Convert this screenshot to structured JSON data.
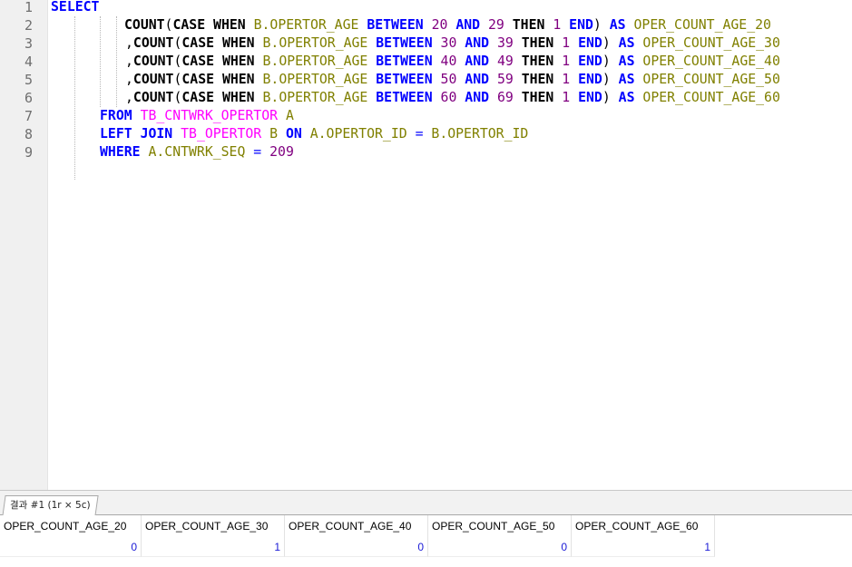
{
  "editor": {
    "line_numbers": [
      "1",
      "2",
      "3",
      "4",
      "5",
      "6",
      "7",
      "8",
      "9"
    ],
    "lines": [
      [
        {
          "t": "SELECT",
          "c": "kw-b"
        }
      ],
      [
        {
          "t": "COUNT",
          "c": "kw-k"
        },
        {
          "t": "(",
          "c": "pn"
        },
        {
          "t": "CASE",
          "c": "kw-k"
        },
        {
          "t": " ",
          "c": "pl"
        },
        {
          "t": "WHEN",
          "c": "kw-k"
        },
        {
          "t": " ",
          "c": "pl"
        },
        {
          "t": "B.OPERTOR_AGE",
          "c": "id"
        },
        {
          "t": " ",
          "c": "pl"
        },
        {
          "t": "BETWEEN",
          "c": "kw-b"
        },
        {
          "t": " ",
          "c": "pl"
        },
        {
          "t": "20",
          "c": "num"
        },
        {
          "t": " ",
          "c": "pl"
        },
        {
          "t": "AND",
          "c": "kw-b"
        },
        {
          "t": " ",
          "c": "pl"
        },
        {
          "t": "29",
          "c": "num"
        },
        {
          "t": " ",
          "c": "pl"
        },
        {
          "t": "THEN",
          "c": "kw-k"
        },
        {
          "t": " ",
          "c": "pl"
        },
        {
          "t": "1",
          "c": "num"
        },
        {
          "t": " ",
          "c": "pl"
        },
        {
          "t": "END",
          "c": "kw-b"
        },
        {
          "t": ")",
          "c": "pn"
        },
        {
          "t": " ",
          "c": "pl"
        },
        {
          "t": "AS",
          "c": "kw-b"
        },
        {
          "t": " ",
          "c": "pl"
        },
        {
          "t": "OPER_COUNT_AGE_20",
          "c": "id"
        }
      ],
      [
        {
          "t": ",",
          "c": "pn"
        },
        {
          "t": "COUNT",
          "c": "kw-k"
        },
        {
          "t": "(",
          "c": "pn"
        },
        {
          "t": "CASE",
          "c": "kw-k"
        },
        {
          "t": " ",
          "c": "pl"
        },
        {
          "t": "WHEN",
          "c": "kw-k"
        },
        {
          "t": " ",
          "c": "pl"
        },
        {
          "t": "B.OPERTOR_AGE",
          "c": "id"
        },
        {
          "t": " ",
          "c": "pl"
        },
        {
          "t": "BETWEEN",
          "c": "kw-b"
        },
        {
          "t": " ",
          "c": "pl"
        },
        {
          "t": "30",
          "c": "num"
        },
        {
          "t": " ",
          "c": "pl"
        },
        {
          "t": "AND",
          "c": "kw-b"
        },
        {
          "t": " ",
          "c": "pl"
        },
        {
          "t": "39",
          "c": "num"
        },
        {
          "t": " ",
          "c": "pl"
        },
        {
          "t": "THEN",
          "c": "kw-k"
        },
        {
          "t": " ",
          "c": "pl"
        },
        {
          "t": "1",
          "c": "num"
        },
        {
          "t": " ",
          "c": "pl"
        },
        {
          "t": "END",
          "c": "kw-b"
        },
        {
          "t": ")",
          "c": "pn"
        },
        {
          "t": " ",
          "c": "pl"
        },
        {
          "t": "AS",
          "c": "kw-b"
        },
        {
          "t": " ",
          "c": "pl"
        },
        {
          "t": "OPER_COUNT_AGE_30",
          "c": "id"
        }
      ],
      [
        {
          "t": ",",
          "c": "pn"
        },
        {
          "t": "COUNT",
          "c": "kw-k"
        },
        {
          "t": "(",
          "c": "pn"
        },
        {
          "t": "CASE",
          "c": "kw-k"
        },
        {
          "t": " ",
          "c": "pl"
        },
        {
          "t": "WHEN",
          "c": "kw-k"
        },
        {
          "t": " ",
          "c": "pl"
        },
        {
          "t": "B.OPERTOR_AGE",
          "c": "id"
        },
        {
          "t": " ",
          "c": "pl"
        },
        {
          "t": "BETWEEN",
          "c": "kw-b"
        },
        {
          "t": " ",
          "c": "pl"
        },
        {
          "t": "40",
          "c": "num"
        },
        {
          "t": " ",
          "c": "pl"
        },
        {
          "t": "AND",
          "c": "kw-b"
        },
        {
          "t": " ",
          "c": "pl"
        },
        {
          "t": "49",
          "c": "num"
        },
        {
          "t": " ",
          "c": "pl"
        },
        {
          "t": "THEN",
          "c": "kw-k"
        },
        {
          "t": " ",
          "c": "pl"
        },
        {
          "t": "1",
          "c": "num"
        },
        {
          "t": " ",
          "c": "pl"
        },
        {
          "t": "END",
          "c": "kw-b"
        },
        {
          "t": ")",
          "c": "pn"
        },
        {
          "t": " ",
          "c": "pl"
        },
        {
          "t": "AS",
          "c": "kw-b"
        },
        {
          "t": " ",
          "c": "pl"
        },
        {
          "t": "OPER_COUNT_AGE_40",
          "c": "id"
        }
      ],
      [
        {
          "t": ",",
          "c": "pn"
        },
        {
          "t": "COUNT",
          "c": "kw-k"
        },
        {
          "t": "(",
          "c": "pn"
        },
        {
          "t": "CASE",
          "c": "kw-k"
        },
        {
          "t": " ",
          "c": "pl"
        },
        {
          "t": "WHEN",
          "c": "kw-k"
        },
        {
          "t": " ",
          "c": "pl"
        },
        {
          "t": "B.OPERTOR_AGE",
          "c": "id"
        },
        {
          "t": " ",
          "c": "pl"
        },
        {
          "t": "BETWEEN",
          "c": "kw-b"
        },
        {
          "t": " ",
          "c": "pl"
        },
        {
          "t": "50",
          "c": "num"
        },
        {
          "t": " ",
          "c": "pl"
        },
        {
          "t": "AND",
          "c": "kw-b"
        },
        {
          "t": " ",
          "c": "pl"
        },
        {
          "t": "59",
          "c": "num"
        },
        {
          "t": " ",
          "c": "pl"
        },
        {
          "t": "THEN",
          "c": "kw-k"
        },
        {
          "t": " ",
          "c": "pl"
        },
        {
          "t": "1",
          "c": "num"
        },
        {
          "t": " ",
          "c": "pl"
        },
        {
          "t": "END",
          "c": "kw-b"
        },
        {
          "t": ")",
          "c": "pn"
        },
        {
          "t": " ",
          "c": "pl"
        },
        {
          "t": "AS",
          "c": "kw-b"
        },
        {
          "t": " ",
          "c": "pl"
        },
        {
          "t": "OPER_COUNT_AGE_50",
          "c": "id"
        }
      ],
      [
        {
          "t": ",",
          "c": "pn"
        },
        {
          "t": "COUNT",
          "c": "kw-k"
        },
        {
          "t": "(",
          "c": "pn"
        },
        {
          "t": "CASE",
          "c": "kw-k"
        },
        {
          "t": " ",
          "c": "pl"
        },
        {
          "t": "WHEN",
          "c": "kw-k"
        },
        {
          "t": " ",
          "c": "pl"
        },
        {
          "t": "B.OPERTOR_AGE",
          "c": "id"
        },
        {
          "t": " ",
          "c": "pl"
        },
        {
          "t": "BETWEEN",
          "c": "kw-b"
        },
        {
          "t": " ",
          "c": "pl"
        },
        {
          "t": "60",
          "c": "num"
        },
        {
          "t": " ",
          "c": "pl"
        },
        {
          "t": "AND",
          "c": "kw-b"
        },
        {
          "t": " ",
          "c": "pl"
        },
        {
          "t": "69",
          "c": "num"
        },
        {
          "t": " ",
          "c": "pl"
        },
        {
          "t": "THEN",
          "c": "kw-k"
        },
        {
          "t": " ",
          "c": "pl"
        },
        {
          "t": "1",
          "c": "num"
        },
        {
          "t": " ",
          "c": "pl"
        },
        {
          "t": "END",
          "c": "kw-b"
        },
        {
          "t": ")",
          "c": "pn"
        },
        {
          "t": " ",
          "c": "pl"
        },
        {
          "t": "AS",
          "c": "kw-b"
        },
        {
          "t": " ",
          "c": "pl"
        },
        {
          "t": "OPER_COUNT_AGE_60",
          "c": "id"
        }
      ],
      [
        {
          "t": "FROM",
          "c": "kw-b"
        },
        {
          "t": " ",
          "c": "pl"
        },
        {
          "t": "TB_CNTWRK_OPERTOR",
          "c": "tb"
        },
        {
          "t": " ",
          "c": "pl"
        },
        {
          "t": "A",
          "c": "id"
        }
      ],
      [
        {
          "t": "LEFT",
          "c": "kw-b"
        },
        {
          "t": " ",
          "c": "pl"
        },
        {
          "t": "JOIN",
          "c": "kw-b"
        },
        {
          "t": " ",
          "c": "pl"
        },
        {
          "t": "TB_OPERTOR",
          "c": "tb"
        },
        {
          "t": " ",
          "c": "pl"
        },
        {
          "t": "B",
          "c": "id"
        },
        {
          "t": " ",
          "c": "pl"
        },
        {
          "t": "ON",
          "c": "kw-b"
        },
        {
          "t": " ",
          "c": "pl"
        },
        {
          "t": "A.OPERTOR_ID",
          "c": "id"
        },
        {
          "t": " ",
          "c": "pl"
        },
        {
          "t": "=",
          "c": "op"
        },
        {
          "t": " ",
          "c": "pl"
        },
        {
          "t": "B.OPERTOR_ID",
          "c": "id"
        }
      ],
      [
        {
          "t": "WHERE",
          "c": "kw-b"
        },
        {
          "t": " ",
          "c": "pl"
        },
        {
          "t": "A.CNTWRK_SEQ",
          "c": "id"
        },
        {
          "t": " ",
          "c": "pl"
        },
        {
          "t": "=",
          "c": "op"
        },
        {
          "t": " ",
          "c": "pl"
        },
        {
          "t": "209",
          "c": "num"
        }
      ]
    ]
  },
  "results": {
    "tab_label": "결과 #1 (1r × 5c)",
    "columns": [
      "OPER_COUNT_AGE_20",
      "OPER_COUNT_AGE_30",
      "OPER_COUNT_AGE_40",
      "OPER_COUNT_AGE_50",
      "OPER_COUNT_AGE_60"
    ],
    "rows": [
      [
        "0",
        "1",
        "0",
        "0",
        "1"
      ]
    ]
  },
  "colors": {
    "keyword_blue": "#0000ff",
    "identifier_olive": "#808000",
    "number_purple": "#800080",
    "table_magenta": "#ff00ff",
    "result_value_blue": "#1a1ad6"
  }
}
